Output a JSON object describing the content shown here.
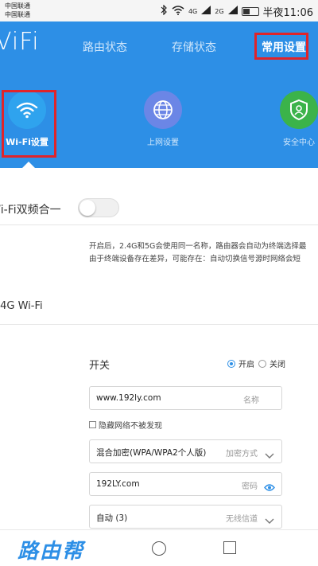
{
  "status_bar": {
    "carrier1": "中国联通",
    "carrier2": "中国联通",
    "signal_label1": "4G",
    "signal_label2": "2G",
    "time": "半夜11:06"
  },
  "header": {
    "brand": "ViFi",
    "tabs": [
      "路由状态",
      "存储状态",
      "常用设置"
    ],
    "active_tab": "常用设置",
    "menu": [
      {
        "label": "Wi-Fi设置",
        "icon": "wifi-icon",
        "color": "#2fa3ee"
      },
      {
        "label": "上网设置",
        "icon": "globe-icon",
        "color": "#6b86e6"
      },
      {
        "label": "安全中心",
        "icon": "shield-user-icon",
        "color": "#3bb34a"
      }
    ]
  },
  "dual_band": {
    "label": "/i-Fi双频合一",
    "enabled": false,
    "desc_line1": "开启后，2.4G和5G会使用同一名称，路由器会自动为终端选择最",
    "desc_line2": "由于终端设备存在差异，可能存在：自动切换信号源时网络会短"
  },
  "section_24g": {
    "title": ".4G Wi-Fi",
    "switch_label": "开关",
    "radio_on": "开启",
    "radio_off": "关闭",
    "name_value": "www.192ly.com",
    "name_hint": "名称",
    "hide_network": "隐藏网络不被发现",
    "encryption_value": "混合加密(WPA/WPA2个人版)",
    "encryption_hint": "加密方式",
    "password_value": "192LY.com",
    "password_hint": "密码",
    "channel_value": "自动 (3)",
    "channel_hint": "无线信道"
  },
  "footer": {
    "watermark": "路由帮"
  },
  "colors": {
    "header_blue": "#2d8fe6",
    "highlight_red": "#e0242a"
  }
}
